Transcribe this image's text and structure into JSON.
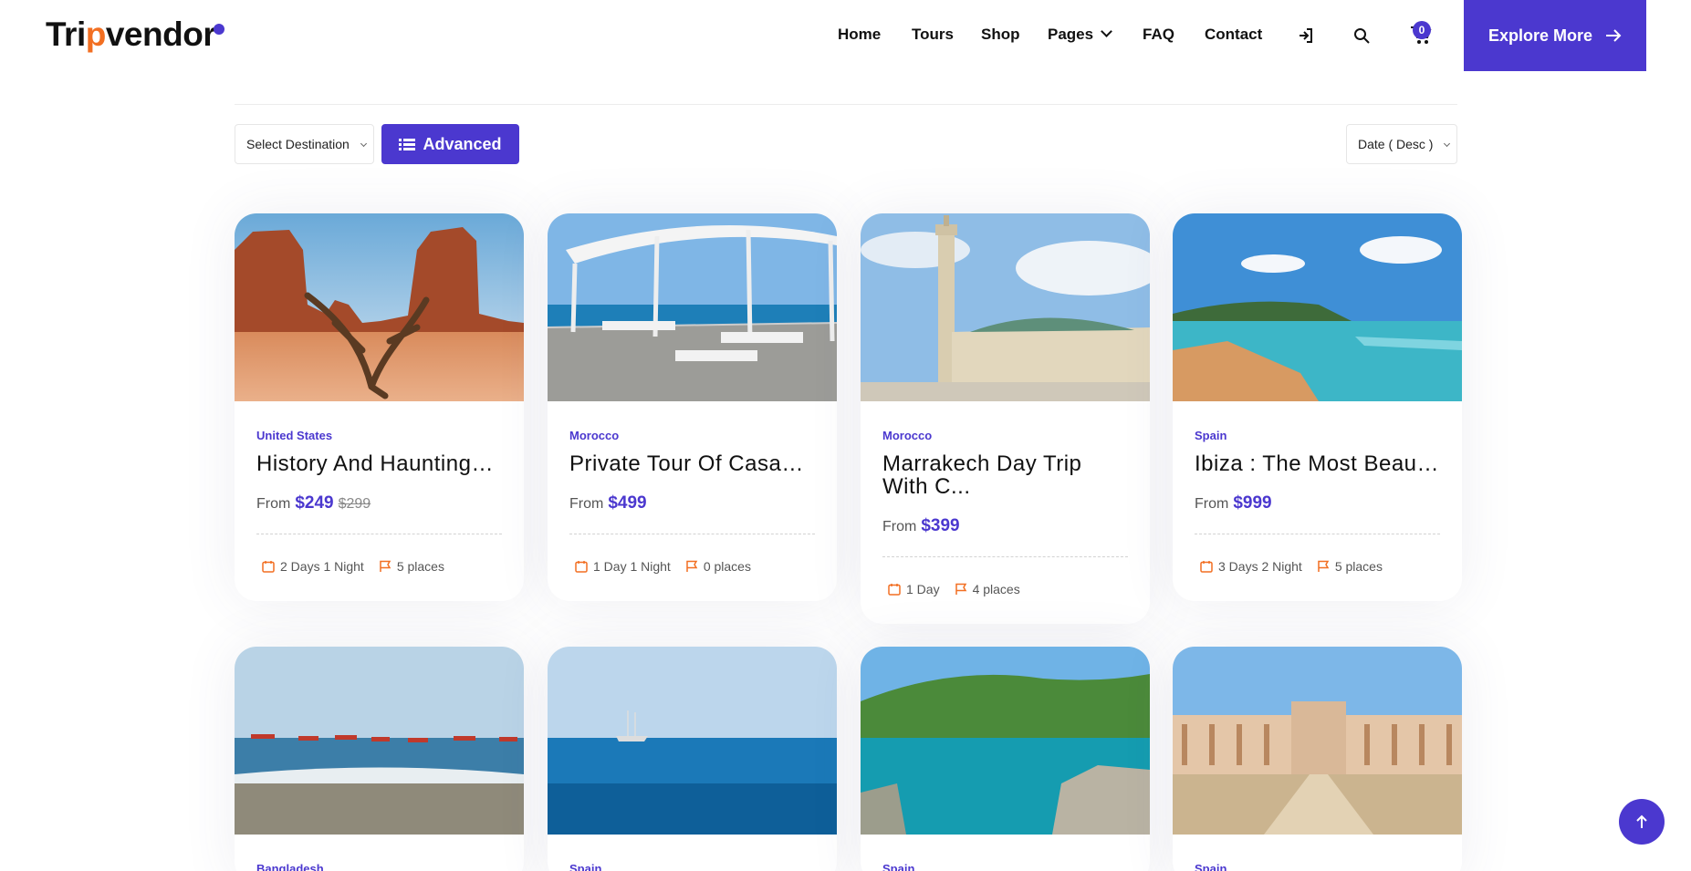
{
  "brand": {
    "name_pre": "Tri",
    "name_pin": "p",
    "name_post": "vendor"
  },
  "nav": {
    "home": "Home",
    "tours": "Tours",
    "shop": "Shop",
    "pages": "Pages",
    "faq": "FAQ",
    "contact": "Contact",
    "cart_count": "0",
    "explore": "Explore More"
  },
  "filters": {
    "destination": "Select Destination",
    "advanced": "Advanced",
    "sort": "Date ( Desc )"
  },
  "colors": {
    "accent": "#4b38cf",
    "orange": "#f26f22"
  },
  "cards": [
    {
      "country": "United States",
      "title": "History And Hauntings Of...",
      "from": "From",
      "price": "$249",
      "old_price": "$299",
      "duration": "2 Days 1 Night",
      "places": "5 places"
    },
    {
      "country": "Morocco",
      "title": "Private Tour Of Casablanc...",
      "from": "From",
      "price": "$499",
      "old_price": "",
      "duration": "1 Day 1 Night",
      "places": "0 places"
    },
    {
      "country": "Morocco",
      "title": "Marrakech Day Trip With C...",
      "from": "From",
      "price": "$399",
      "old_price": "",
      "duration": "1 Day",
      "places": "4 places"
    },
    {
      "country": "Spain",
      "title": "Ibiza : The Most Beautifu...",
      "from": "From",
      "price": "$999",
      "old_price": "",
      "duration": "3 Days 2 Night",
      "places": "5 places"
    },
    {
      "country": "Bangladesh"
    },
    {
      "country": "Spain"
    },
    {
      "country": "Spain"
    },
    {
      "country": "Spain"
    }
  ]
}
